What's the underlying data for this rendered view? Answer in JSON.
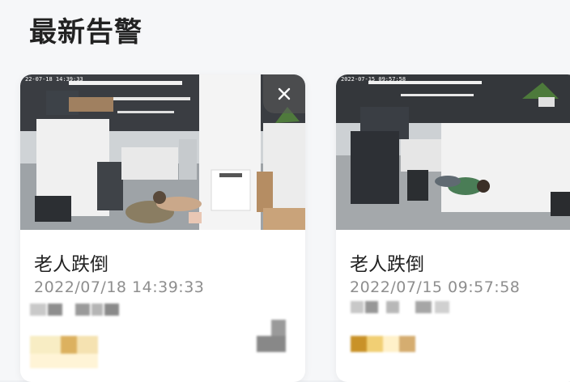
{
  "header": {
    "title": "最新告警"
  },
  "alerts": [
    {
      "title": "老人跌倒",
      "time": "2022/07/18 14:39:33",
      "overlay": "22-07-18  14:39:33",
      "close_icon": "close-icon"
    },
    {
      "title": "老人跌倒",
      "time": "2022/07/15 09:57:58",
      "overlay": "2022-07-15 09:57:58"
    }
  ],
  "colors": {
    "accent": "#d6a84a",
    "title": "#222222",
    "muted": "#8e8e8e"
  }
}
